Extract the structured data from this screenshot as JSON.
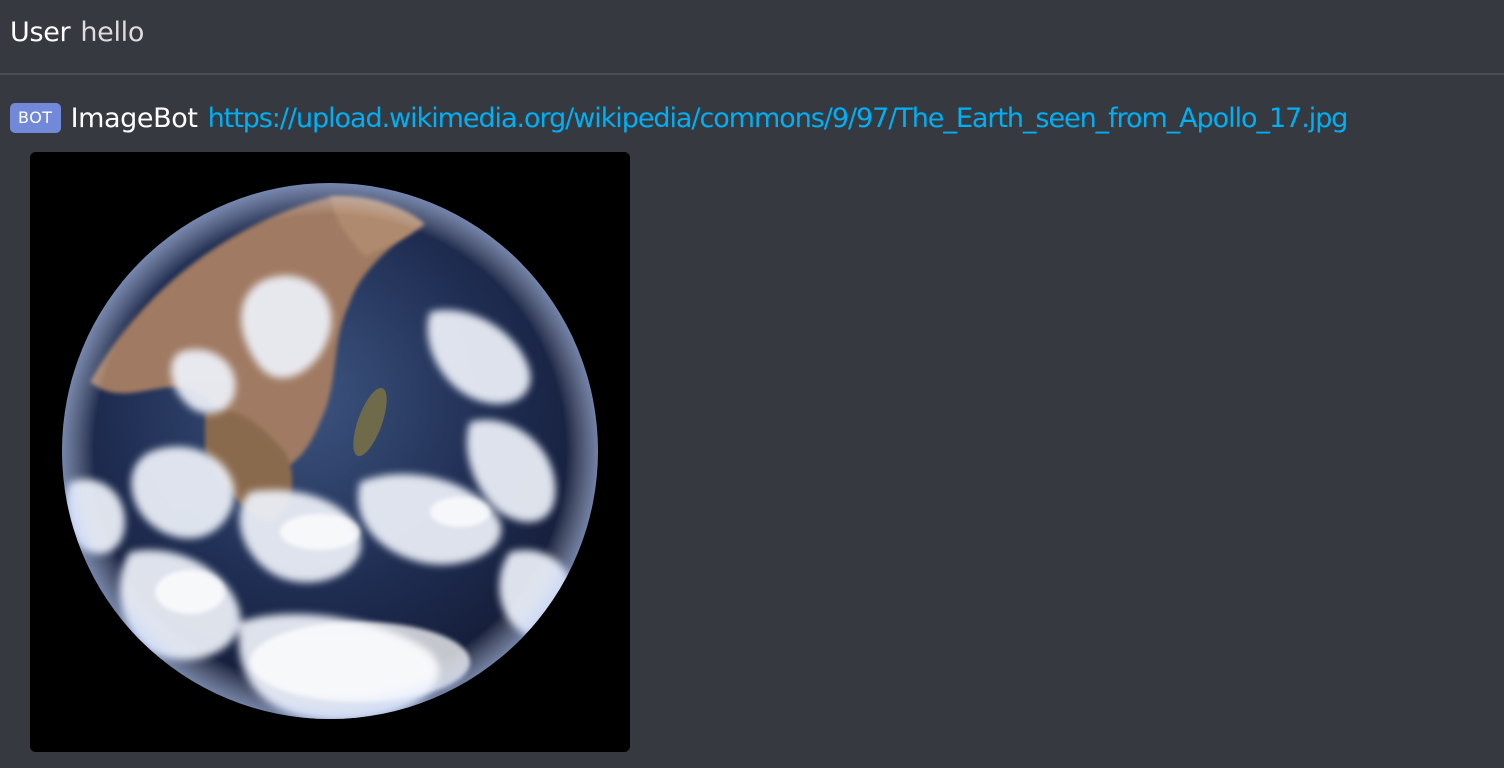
{
  "messages": [
    {
      "author": "User",
      "content": "hello"
    },
    {
      "tag": "BOT",
      "author": "ImageBot",
      "link": "https://upload.wikimedia.org/wikipedia/commons/9/97/The_Earth_seen_from_Apollo_17.jpg",
      "attachment": {
        "image": "earth-photo",
        "subject": "Earth seen from space"
      }
    }
  ],
  "colors": {
    "background": "#36393f",
    "divider": "#4a4d54",
    "bot_tag": "#7289da",
    "link": "#00aff4",
    "author": "#ffffff",
    "text": "#dcddde"
  }
}
